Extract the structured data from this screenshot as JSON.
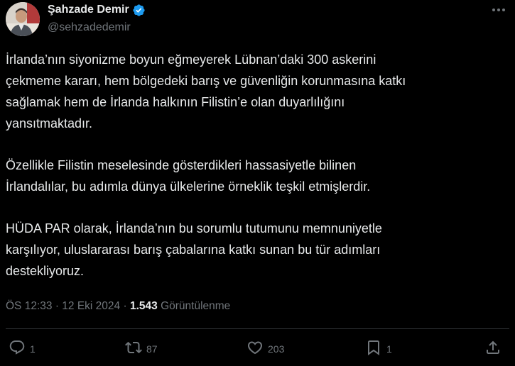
{
  "author": {
    "display_name": "Şahzade Demir",
    "handle": "@sehzadedemir",
    "verified": true,
    "verified_color": "#1d9bf0"
  },
  "post": {
    "paragraphs": [
      "İrlanda’nın siyonizme boyun eğmeyerek Lübnan’daki 300 askerini\nçekmeme kararı, hem bölgedeki barış ve güvenliğin korunmasına katkı\nsağlamak hem de İrlanda halkının Filistin’e olan duyarlılığını\nyansıtmaktadır.",
      "Özellikle Filistin meselesinde gösterdikleri hassasiyetle bilinen\nİrlandalılar, bu adımla dünya ülkelerine örneklik teşkil etmişlerdir.",
      "HÜDA PAR olarak, İrlanda’nın bu sorumlu tutumunu memnuniyetle\nkarşılıyor, uluslararası barış çabalarına katkı sunan bu tür adımları\ndestekliyoruz."
    ]
  },
  "meta": {
    "time": "ÖS 12:33",
    "date": "12 Eki 2024",
    "separator": "·",
    "views_count": "1.543",
    "views_label": "Görüntülenme"
  },
  "actions": {
    "reply": {
      "icon": "reply-icon",
      "count": "1"
    },
    "repost": {
      "icon": "repost-icon",
      "count": "87"
    },
    "like": {
      "icon": "heart-icon",
      "count": "203"
    },
    "bookmark": {
      "icon": "bookmark-icon",
      "count": "1"
    },
    "share": {
      "icon": "share-icon"
    }
  },
  "colors": {
    "background": "#000000",
    "text": "#e7e9ea",
    "secondary": "#71767b",
    "divider": "#2f3336"
  }
}
